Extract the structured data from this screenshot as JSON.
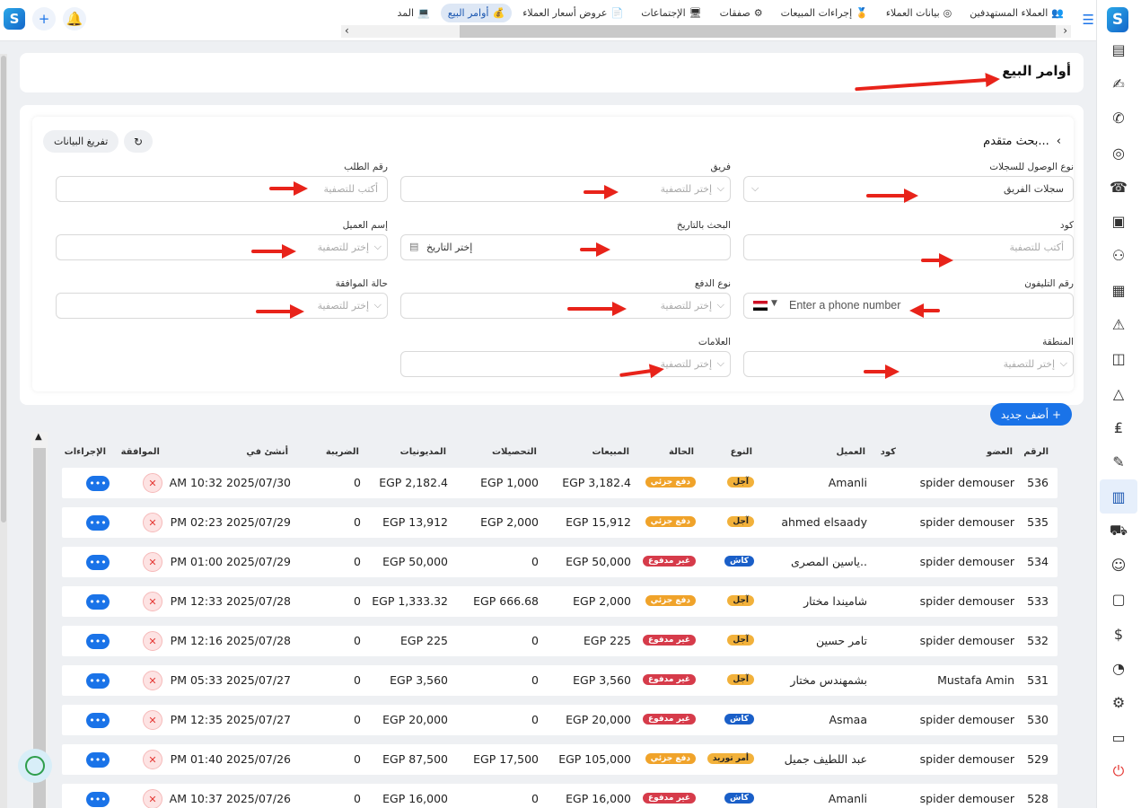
{
  "tabs": [
    {
      "label": "العملاء المستهدفين",
      "icon": "👥",
      "active": false
    },
    {
      "label": "بيانات العملاء",
      "icon": "◎",
      "active": false
    },
    {
      "label": "إجراءات المبيعات",
      "icon": "🏅",
      "active": false
    },
    {
      "label": "صفقات",
      "icon": "⚙",
      "active": false
    },
    {
      "label": "الإجتماعات",
      "icon": "🖥",
      "active": false
    },
    {
      "label": "عروض أسعار العملاء",
      "icon": "📄",
      "active": false
    },
    {
      "label": "أوامر البيع",
      "icon": "💰",
      "active": true
    },
    {
      "label": "المد",
      "icon": "💻",
      "active": false
    }
  ],
  "page_title": "أوامر البيع",
  "filters": {
    "advanced_label": "بحث متقدم...",
    "clear_label": "تفريغ البيانات",
    "fields": {
      "record_access": {
        "label": "نوع الوصول للسجلات",
        "value": "سجلات الفريق"
      },
      "team": {
        "label": "فريق",
        "placeholder": "إختر للتصفية"
      },
      "order_number": {
        "label": "رقم الطلب",
        "placeholder": "أكتب للتصفية"
      },
      "code": {
        "label": "كود",
        "placeholder": "أكتب للتصفية"
      },
      "date_search": {
        "label": "البحث بالتاريخ",
        "placeholder": "إختر التاريخ"
      },
      "client_name": {
        "label": "إسم العميل",
        "placeholder": "إختر للتصفية"
      },
      "phone": {
        "label": "رقم التليفون",
        "placeholder": "Enter a phone number"
      },
      "payment_type": {
        "label": "نوع الدفع",
        "placeholder": "إختر للتصفية"
      },
      "approval_status": {
        "label": "حالة الموافقة",
        "placeholder": "إختر للتصفية"
      },
      "region": {
        "label": "المنطقة",
        "placeholder": "إختر للتصفية"
      },
      "tags": {
        "label": "العلامات",
        "placeholder": "إختر للتصفية"
      }
    }
  },
  "add_new_label": "أضف جديد",
  "table": {
    "headers": {
      "number": "الرقم",
      "member": "العضو",
      "code": "كود",
      "client": "العميل",
      "type": "النوع",
      "status": "الحالة",
      "sales": "المبيعات",
      "collections": "التحصيلات",
      "debts": "المديونيات",
      "tax": "الضريبة",
      "created": "أنشئ في",
      "approval": "الموافقة",
      "actions": "الإجراءات"
    },
    "rows": [
      {
        "number": "536",
        "member": "spider demouser",
        "client": "Amanli",
        "type": "آجل",
        "status": "دفع جزئي",
        "sales": "EGP 3,182.4",
        "collections": "EGP 1,000",
        "debts": "EGP 2,182.4",
        "tax": "0",
        "created": "AM 10:32 2025/07/30"
      },
      {
        "number": "535",
        "member": "spider demouser",
        "client": "ahmed elsaady",
        "type": "آجل",
        "status": "دفع جزئي",
        "sales": "EGP 15,912",
        "collections": "EGP 2,000",
        "debts": "EGP 13,912",
        "tax": "0",
        "created": "PM 02:23 2025/07/29"
      },
      {
        "number": "534",
        "member": "spider demouser",
        "client": "ياسين المصرى..",
        "type": "كاش",
        "status": "غير مدفوع",
        "sales": "EGP 50,000",
        "collections": "0",
        "debts": "EGP 50,000",
        "tax": "0",
        "created": "PM 01:00 2025/07/29"
      },
      {
        "number": "533",
        "member": "spider demouser",
        "client": "شاميندا مختار",
        "type": "آجل",
        "status": "دفع جزئي",
        "sales": "EGP 2,000",
        "collections": "EGP 666.68",
        "debts": "EGP 1,333.32",
        "tax": "0",
        "created": "PM 12:33 2025/07/28"
      },
      {
        "number": "532",
        "member": "spider demouser",
        "client": "تامر حسين",
        "type": "آجل",
        "status": "غير مدفوع",
        "sales": "EGP 225",
        "collections": "0",
        "debts": "EGP 225",
        "tax": "0",
        "created": "PM 12:16 2025/07/28"
      },
      {
        "number": "531",
        "member": "Mustafa Amin",
        "client": "بشمهندس مختار",
        "type": "آجل",
        "status": "غير مدفوع",
        "sales": "EGP 3,560",
        "collections": "0",
        "debts": "EGP 3,560",
        "tax": "0",
        "created": "PM 05:33 2025/07/27"
      },
      {
        "number": "530",
        "member": "spider demouser",
        "client": "Asmaa",
        "type": "كاش",
        "status": "غير مدفوع",
        "sales": "EGP 20,000",
        "collections": "0",
        "debts": "EGP 20,000",
        "tax": "0",
        "created": "PM 12:35 2025/07/27"
      },
      {
        "number": "529",
        "member": "spider demouser",
        "client": "عبد اللطيف جميل",
        "type": "أمر توريد",
        "status": "دفع جزئي",
        "sales": "EGP 105,000",
        "collections": "EGP 17,500",
        "debts": "EGP 87,500",
        "tax": "0",
        "created": "PM 01:40 2025/07/26"
      },
      {
        "number": "528",
        "member": "spider demouser",
        "client": "Amanli",
        "type": "كاش",
        "status": "غير مدفوع",
        "sales": "EGP 16,000",
        "collections": "0",
        "debts": "EGP 16,000",
        "tax": "0",
        "created": "AM 10:37 2025/07/26"
      }
    ]
  },
  "colors": {
    "accent": "#1a73e8",
    "arrow": "#e8231a",
    "partial": "#f0a32a",
    "unpaid": "#d63b4a",
    "cash": "#1a5fc8"
  }
}
